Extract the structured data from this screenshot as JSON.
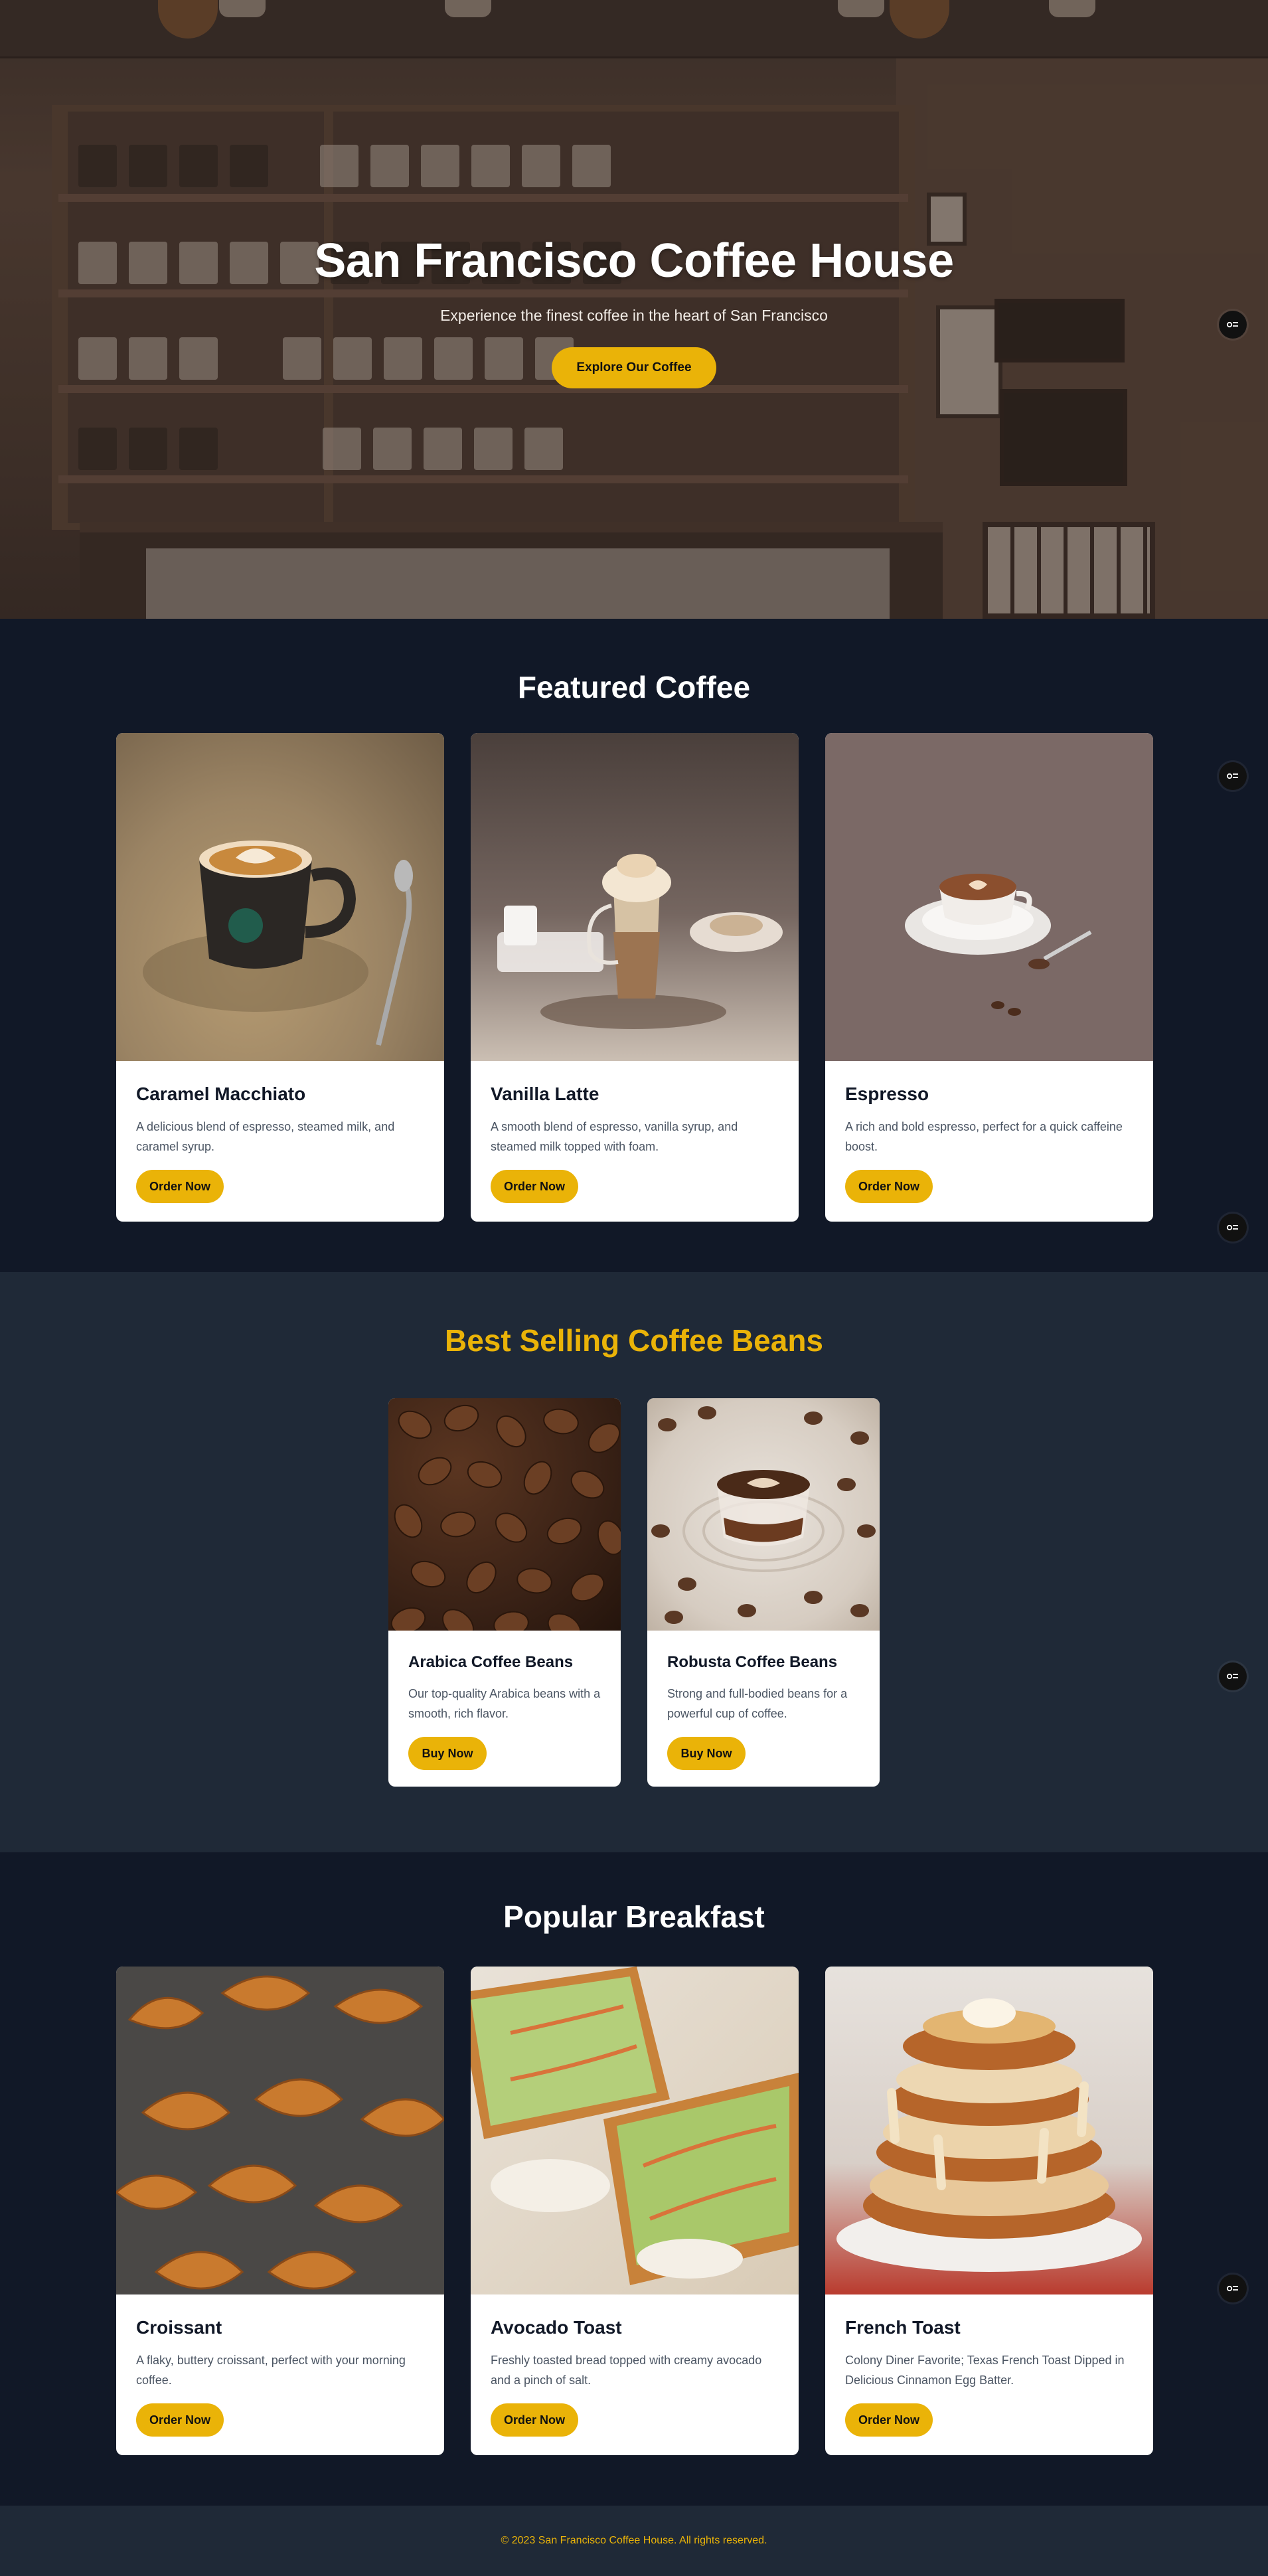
{
  "hero": {
    "title": "San Francisco Coffee House",
    "subtitle": "Experience the finest coffee in the heart of San Francisco",
    "cta_label": "Explore Our Coffee"
  },
  "featured": {
    "title": "Featured Coffee",
    "items": [
      {
        "name": "Caramel Macchiato",
        "description": "A delicious blend of espresso, steamed milk, and caramel syrup.",
        "button": "Order Now",
        "image_icon": "latte-art-cup-icon"
      },
      {
        "name": "Vanilla Latte",
        "description": "A smooth blend of espresso, vanilla syrup, and steamed milk topped with foam.",
        "button": "Order Now",
        "image_icon": "glass-latte-icon"
      },
      {
        "name": "Espresso",
        "description": "A rich and bold espresso, perfect for a quick caffeine boost.",
        "button": "Order Now",
        "image_icon": "espresso-cup-icon"
      }
    ]
  },
  "beans": {
    "title": "Best Selling Coffee Beans",
    "items": [
      {
        "name": "Arabica Coffee Beans",
        "description": "Our top-quality Arabica beans with a smooth, rich flavor.",
        "button": "Buy Now",
        "image_icon": "coffee-beans-icon"
      },
      {
        "name": "Robusta Coffee Beans",
        "description": "Strong and full-bodied beans for a powerful cup of coffee.",
        "button": "Buy Now",
        "image_icon": "coffee-cup-beans-icon"
      }
    ]
  },
  "breakfast": {
    "title": "Popular Breakfast",
    "items": [
      {
        "name": "Croissant",
        "description": "A flaky, buttery croissant, perfect with your morning coffee.",
        "button": "Order Now",
        "image_icon": "croissant-icon"
      },
      {
        "name": "Avocado Toast",
        "description": "Freshly toasted bread topped with creamy avocado and a pinch of salt.",
        "button": "Order Now",
        "image_icon": "avocado-toast-icon"
      },
      {
        "name": "French Toast",
        "description": "Colony Diner Favorite; Texas French Toast Dipped in Delicious Cinnamon Egg Batter.",
        "button": "Order Now",
        "image_icon": "french-toast-icon"
      }
    ]
  },
  "footer": {
    "copyright": "© 2023 San Francisco Coffee House. All rights reserved."
  },
  "colors": {
    "accent": "#eab308",
    "dark_bg": "#111827",
    "mid_bg": "#1f2937",
    "card_bg": "#ffffff"
  },
  "floating_widget_icon": "settings-toggle-icon"
}
